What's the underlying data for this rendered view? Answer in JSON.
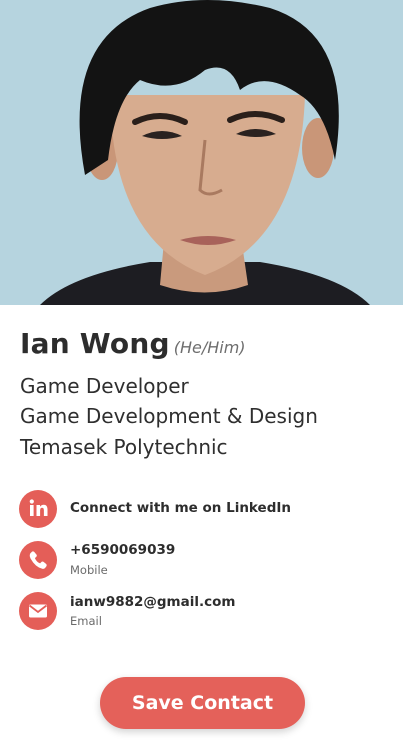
{
  "profile": {
    "name": "Ian Wong",
    "pronouns": "(He/Him)",
    "title": "Game Developer",
    "course": "Game Development & Design",
    "school": "Temasek Polytechnic"
  },
  "contacts": [
    {
      "icon": "linkedin-icon",
      "label": "Connect with me on LinkedIn"
    },
    {
      "icon": "phone-icon",
      "label": "+6590069039",
      "type": "Mobile"
    },
    {
      "icon": "email-icon",
      "label": "ianw9882@gmail.com",
      "type": "Email"
    }
  ],
  "actions": {
    "save_label": "Save Contact"
  },
  "colors": {
    "accent": "#e45e58",
    "photo_background": "#b5d3de"
  }
}
